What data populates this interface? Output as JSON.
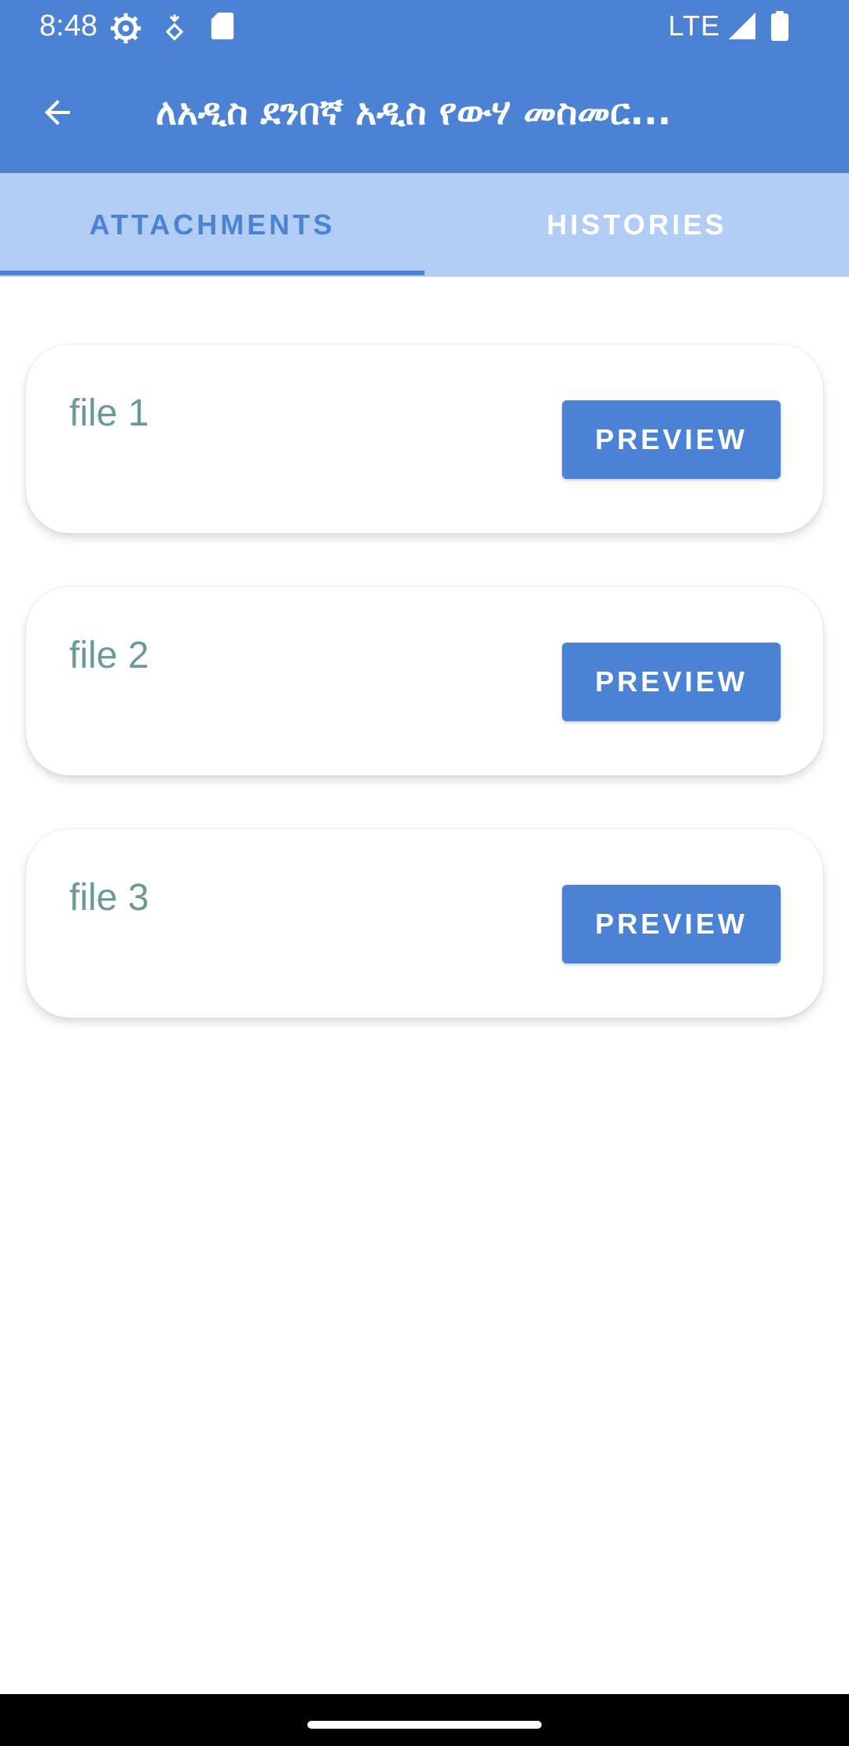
{
  "status_bar": {
    "time": "8:48",
    "network": "LTE",
    "icons": [
      "gear-icon",
      "location-icon",
      "sd-card-icon",
      "signal-icon",
      "battery-icon"
    ]
  },
  "app_bar": {
    "title": "ለአዲስ ደንበኛ አዲስ የውሃ መስመር...",
    "back_icon": "arrow-left-icon"
  },
  "tabs": [
    {
      "label": "ATTACHMENTS",
      "selected": true
    },
    {
      "label": "HISTORIES",
      "selected": false
    }
  ],
  "files": [
    {
      "name": "file 1",
      "action_label": "PREVIEW"
    },
    {
      "name": "file 2",
      "action_label": "PREVIEW"
    },
    {
      "name": "file 3",
      "action_label": "PREVIEW"
    }
  ],
  "colors": {
    "primary": "#4c82d4",
    "tab_bar": "#b2cdf5",
    "file_text": "#6a9a94"
  }
}
